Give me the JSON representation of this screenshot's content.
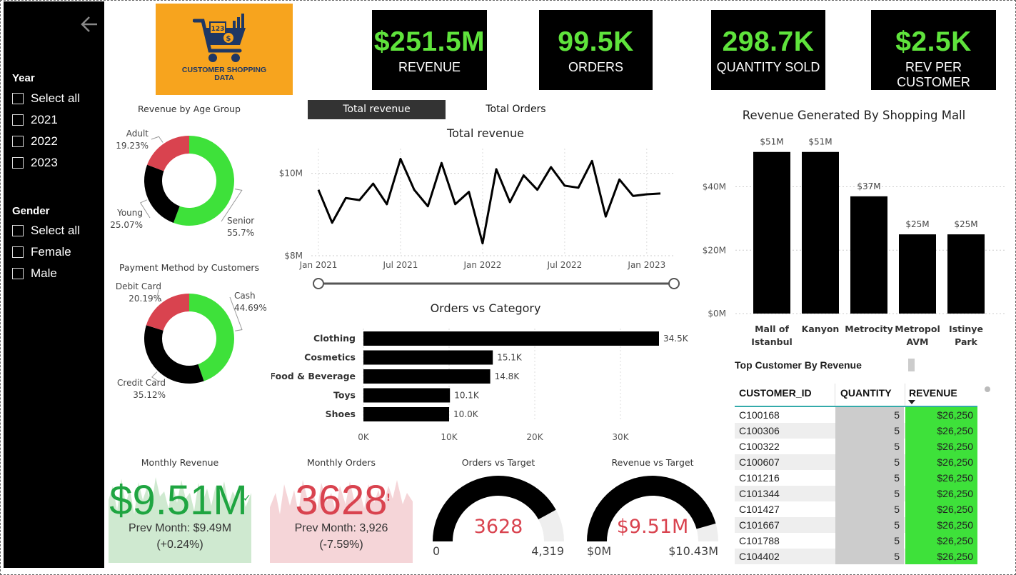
{
  "sidebar": {
    "year_title": "Year",
    "year_options": [
      "Select all",
      "2021",
      "2022",
      "2023"
    ],
    "gender_title": "Gender",
    "gender_options": [
      "Select all",
      "Female",
      "Male"
    ]
  },
  "logo": {
    "text_line1": "CUSTOMER SHOPPING",
    "text_line2": "DATA",
    "badge": "123"
  },
  "kpis": [
    {
      "value": "$251.5M",
      "label": "REVENUE"
    },
    {
      "value": "99.5K",
      "label": "ORDERS"
    },
    {
      "value": "298.7K",
      "label": "QUANTITY SOLD"
    },
    {
      "value": "$2.5K",
      "label": "REV PER CUSTOMER"
    }
  ],
  "colors": {
    "green": "#3ee13a",
    "red": "#d9434f",
    "black": "#000000",
    "orange": "#f7a41e",
    "kpi_green": "#5fe33c",
    "gauge_red": "#d9434f"
  },
  "age_donut": {
    "title": "Revenue by Age Group",
    "slices": [
      {
        "name": "Senior",
        "pct": "55.7%",
        "value": 55.7,
        "color": "#3ee13a"
      },
      {
        "name": "Young",
        "pct": "25.07%",
        "value": 25.07,
        "color": "#000000"
      },
      {
        "name": "Adult",
        "pct": "19.23%",
        "value": 19.23,
        "color": "#d9434f"
      }
    ]
  },
  "payment_donut": {
    "title": "Payment Method by Customers",
    "slices": [
      {
        "name": "Cash",
        "pct": "44.69%",
        "value": 44.69,
        "color": "#3ee13a"
      },
      {
        "name": "Credit Card",
        "pct": "35.12%",
        "value": 35.12,
        "color": "#000000"
      },
      {
        "name": "Debit Card",
        "pct": "20.19%",
        "value": 20.19,
        "color": "#d9434f"
      }
    ]
  },
  "toggle": {
    "active": "Total revenue",
    "inactive": "Total Orders"
  },
  "chart_data": [
    {
      "type": "line",
      "title": "Total revenue",
      "y_ticks": [
        "$10M",
        "$8M"
      ],
      "x_ticks": [
        "Jan 2021",
        "Jul 2021",
        "Jan 2022",
        "Jul 2022",
        "Jan 2023"
      ],
      "x": [
        "2021-01",
        "2021-02",
        "2021-03",
        "2021-04",
        "2021-05",
        "2021-06",
        "2021-07",
        "2021-08",
        "2021-09",
        "2021-10",
        "2021-11",
        "2021-12",
        "2022-01",
        "2022-02",
        "2022-03",
        "2022-04",
        "2022-05",
        "2022-06",
        "2022-07",
        "2022-08",
        "2022-09",
        "2022-10",
        "2022-11",
        "2022-12",
        "2023-01",
        "2023-02",
        "2023-03"
      ],
      "values": [
        9.6,
        8.8,
        9.4,
        9.35,
        9.75,
        9.25,
        10.35,
        9.6,
        9.2,
        10.25,
        9.25,
        9.55,
        8.3,
        10.1,
        9.3,
        9.95,
        9.6,
        10.15,
        9.7,
        9.65,
        10.3,
        8.95,
        9.85,
        9.45,
        9.49,
        9.51
      ],
      "ylim": [
        8,
        10.6
      ]
    },
    {
      "type": "bar",
      "title": "Orders vs Category",
      "categories": [
        "Clothing",
        "Cosmetics",
        "Food & Beverage",
        "Toys",
        "Shoes"
      ],
      "values": [
        34.5,
        15.1,
        14.8,
        10.1,
        10.0
      ],
      "labels": [
        "34.5K",
        "15.1K",
        "14.8K",
        "10.1K",
        "10.0K"
      ],
      "x_ticks": [
        "0K",
        "10K",
        "20K",
        "30K"
      ],
      "xlim": [
        0,
        35
      ]
    },
    {
      "type": "bar",
      "title": "Revenue Generated By Shopping Mall",
      "categories": [
        "Mall of Istanbul",
        "Kanyon",
        "Metrocity",
        "Metropol AVM",
        "Istinye Park"
      ],
      "category_lines": [
        [
          "Mall of",
          "Istanbul"
        ],
        [
          "Kanyon"
        ],
        [
          "Metrocity"
        ],
        [
          "Metropol",
          "AVM"
        ],
        [
          "Istinye",
          "Park"
        ]
      ],
      "values": [
        51,
        51,
        37,
        25,
        25
      ],
      "labels": [
        "$51M",
        "$51M",
        "$37M",
        "$25M",
        "$25M"
      ],
      "y_ticks": [
        "$40M",
        "$20M",
        "$0M"
      ],
      "ylim": [
        0,
        55
      ]
    }
  ],
  "monthly_revenue": {
    "title": "Monthly Revenue",
    "value": "$9.51M",
    "prev": "Prev Month: $9.49M",
    "change": "(+0.24%)"
  },
  "monthly_orders": {
    "title": "Monthly Orders",
    "value": "3628",
    "prev": "Prev Month: 3,926",
    "change": "(-7.59%)"
  },
  "orders_gauge": {
    "title": "Orders vs Target",
    "value": "3628",
    "min": "0",
    "max": "4,319",
    "fraction": 0.84
  },
  "revenue_gauge": {
    "title": "Revenue vs Target",
    "value": "$9.51M",
    "min": "$0M",
    "max": "$10.43M",
    "fraction": 0.912
  },
  "top_customers": {
    "title": "Top Customer By Revenue",
    "columns": [
      "CUSTOMER_ID",
      "QUANTITY",
      "REVENUE"
    ],
    "rows": [
      [
        "C100168",
        "5",
        "$26,250"
      ],
      [
        "C100306",
        "5",
        "$26,250"
      ],
      [
        "C100322",
        "5",
        "$26,250"
      ],
      [
        "C100607",
        "5",
        "$26,250"
      ],
      [
        "C101216",
        "5",
        "$26,250"
      ],
      [
        "C101344",
        "5",
        "$26,250"
      ],
      [
        "C101427",
        "5",
        "$26,250"
      ],
      [
        "C101667",
        "5",
        "$26,250"
      ],
      [
        "C101788",
        "5",
        "$26,250"
      ],
      [
        "C104402",
        "5",
        "$26,250"
      ]
    ]
  }
}
